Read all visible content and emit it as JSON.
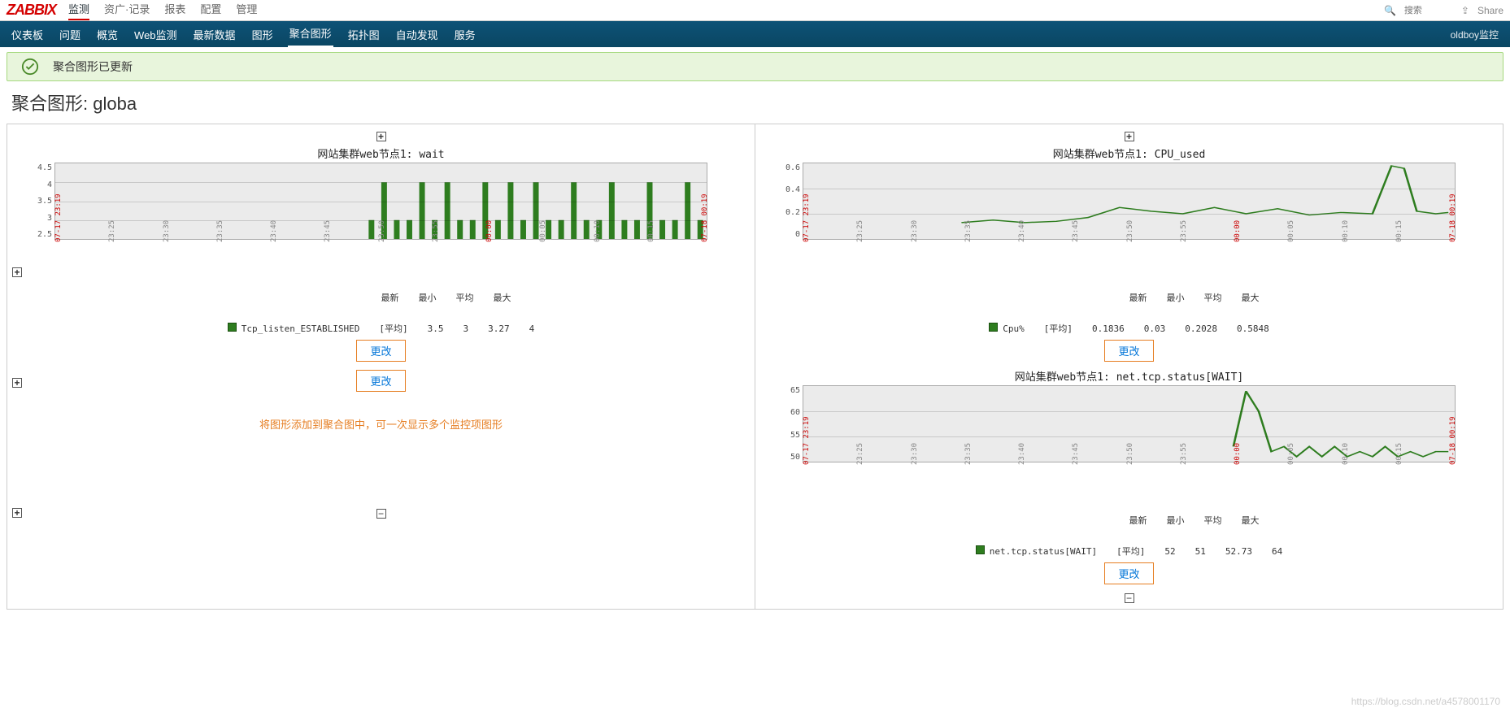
{
  "topbar": {
    "logo": "ZABBIX",
    "items": [
      "监测",
      "资广·记录",
      "报表",
      "配置",
      "管理"
    ],
    "active": 0,
    "search_placeholder": "搜索",
    "share": "Share"
  },
  "subnav": {
    "items": [
      "仪表板",
      "问题",
      "概览",
      "Web监测",
      "最新数据",
      "图形",
      "聚合图形",
      "拓扑图",
      "自动发现",
      "服务"
    ],
    "active": 6,
    "right": "oldboy监控"
  },
  "message": "聚合图形已更新",
  "page_title": "聚合图形: globa",
  "change_label": "更改",
  "add_note": "将图形添加到聚合图中，可一次显示多个监控项图形",
  "legend_cols": [
    "最新",
    "最小",
    "平均",
    "最大"
  ],
  "legend_avg": "[平均]",
  "watermark": "https://blog.csdn.net/a4578001170",
  "x_ticks": [
    "07-17 23:19",
    "23:25",
    "23:30",
    "23:35",
    "23:40",
    "23:45",
    "23:50",
    "23:55",
    "00:00",
    "00:05",
    "00:10",
    "00:15",
    "07-18 00:19"
  ],
  "chart_data": [
    {
      "type": "line",
      "title": "网站集群web节点1: wait",
      "xlabel": "",
      "ylabel": "",
      "ylim": [
        2.5,
        4.5
      ],
      "yticks": [
        4.5,
        4.0,
        3.5,
        3.0,
        2.5
      ],
      "series": [
        {
          "name": "Tcp_listen_ESTABLISHED",
          "x": [
            23.8,
            23.82,
            23.84,
            23.86,
            23.88,
            23.9,
            23.92,
            23.94,
            23.96,
            23.98,
            24.0,
            24.02,
            24.04,
            24.06,
            24.08,
            24.1,
            24.12,
            24.14,
            24.16,
            24.18,
            24.2,
            24.22,
            24.24,
            24.26,
            24.28,
            24.3,
            24.32
          ],
          "values": [
            3,
            4,
            3,
            3,
            4,
            3,
            4,
            3,
            3,
            4,
            3,
            4,
            3,
            4,
            3,
            3,
            4,
            3,
            3,
            4,
            3,
            3,
            4,
            3,
            3,
            4,
            3
          ],
          "stats": {
            "最新": "3.5",
            "最小": "3",
            "平均": "3.27",
            "最大": "4"
          }
        }
      ]
    },
    {
      "type": "line",
      "title": "网站集群web节点1: CPU_used",
      "xlabel": "",
      "ylabel": "",
      "ylim": [
        0,
        0.6
      ],
      "yticks": [
        0.6,
        0.4,
        0.2,
        0
      ],
      "series": [
        {
          "name": "Cpu%",
          "x": [
            23.55,
            23.6,
            23.65,
            23.7,
            23.75,
            23.8,
            23.85,
            23.9,
            23.95,
            24.0,
            24.05,
            24.1,
            24.15,
            24.2,
            24.23,
            24.25,
            24.27,
            24.3,
            24.32
          ],
          "values": [
            0.13,
            0.15,
            0.13,
            0.14,
            0.17,
            0.25,
            0.22,
            0.2,
            0.25,
            0.2,
            0.24,
            0.19,
            0.21,
            0.2,
            0.58,
            0.56,
            0.22,
            0.2,
            0.21
          ],
          "stats": {
            "最新": "0.1836",
            "最小": "0.03",
            "平均": "0.2028",
            "最大": "0.5848"
          }
        }
      ]
    },
    {
      "type": "line",
      "title": "网站集群web节点1: net.tcp.status[WAIT]",
      "xlabel": "",
      "ylabel": "",
      "ylim": [
        50,
        65
      ],
      "yticks": [
        65,
        60,
        55,
        50
      ],
      "series": [
        {
          "name": "net.tcp.status[WAIT]",
          "x": [
            23.98,
            24.0,
            24.02,
            24.04,
            24.06,
            24.08,
            24.1,
            24.12,
            24.14,
            24.16,
            24.18,
            24.2,
            24.22,
            24.24,
            24.26,
            24.28,
            24.3,
            24.32
          ],
          "values": [
            53,
            64,
            60,
            52,
            53,
            51,
            53,
            51,
            53,
            51,
            52,
            51,
            53,
            51,
            52,
            51,
            52,
            52
          ],
          "stats": {
            "最新": "52",
            "最小": "51",
            "平均": "52.73",
            "最大": "64"
          }
        }
      ]
    }
  ]
}
